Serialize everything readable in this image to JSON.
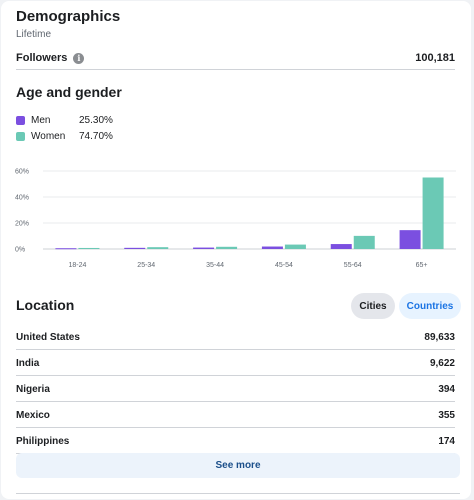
{
  "header": {
    "title": "Demographics",
    "subtitle": "Lifetime"
  },
  "followers": {
    "label": "Followers",
    "value": "100,181",
    "info_icon": "info-icon"
  },
  "age_gender": {
    "title": "Age and gender",
    "legend": [
      {
        "name": "Men",
        "percent": "25.30%",
        "color": "#7b4fe0"
      },
      {
        "name": "Women",
        "percent": "74.70%",
        "color": "#6bc9b5"
      }
    ]
  },
  "chart_data": {
    "type": "bar",
    "categories": [
      "18-24",
      "25-34",
      "35-44",
      "45-54",
      "55-64",
      "65+"
    ],
    "series": [
      {
        "name": "Men",
        "values": [
          0.6,
          0.9,
          1.1,
          1.9,
          3.8,
          14.5
        ],
        "color": "#7b4fe0"
      },
      {
        "name": "Women",
        "values": [
          0.8,
          1.4,
          1.7,
          3.4,
          10.1,
          55.0
        ],
        "color": "#6bc9b5"
      }
    ],
    "yticks": [
      "0%",
      "20%",
      "40%",
      "60%"
    ],
    "ylim": [
      0,
      60
    ],
    "grid": true,
    "legend": "top-left"
  },
  "location": {
    "title": "Location",
    "tabs": [
      {
        "label": "Cities",
        "selected": false
      },
      {
        "label": "Countries",
        "selected": true
      }
    ],
    "rows": [
      {
        "name": "United States",
        "value": "89,633"
      },
      {
        "name": "India",
        "value": "9,622"
      },
      {
        "name": "Nigeria",
        "value": "394"
      },
      {
        "name": "Mexico",
        "value": "355"
      },
      {
        "name": "Philippines",
        "value": "174"
      }
    ],
    "see_more": "See more"
  }
}
